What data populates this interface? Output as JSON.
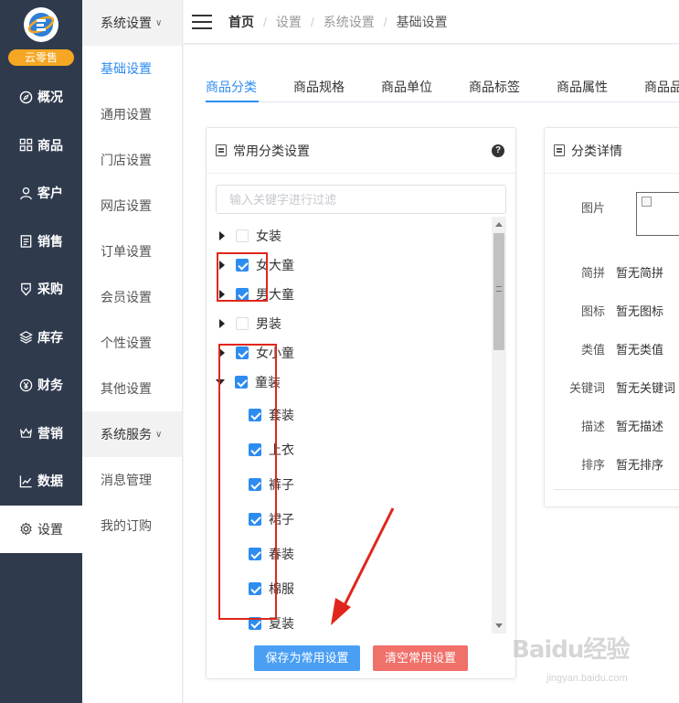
{
  "logo": {
    "badge": "云零售"
  },
  "nav": [
    {
      "label": "概况",
      "icon": "compass-icon"
    },
    {
      "label": "商品",
      "icon": "grid-icon"
    },
    {
      "label": "客户",
      "icon": "user-icon"
    },
    {
      "label": "销售",
      "icon": "clipboard-icon"
    },
    {
      "label": "采购",
      "icon": "badge-icon"
    },
    {
      "label": "库存",
      "icon": "layers-icon"
    },
    {
      "label": "财务",
      "icon": "yen-icon"
    },
    {
      "label": "营销",
      "icon": "crown-icon"
    },
    {
      "label": "数据",
      "icon": "chart-icon"
    },
    {
      "label": "设置",
      "icon": "gear-icon",
      "active": true
    }
  ],
  "submenu": {
    "group1": "系统设置",
    "items1": [
      "基础设置",
      "通用设置",
      "门店设置",
      "网店设置",
      "订单设置",
      "会员设置",
      "个性设置",
      "其他设置"
    ],
    "group2": "系统服务",
    "items2": [
      "消息管理",
      "我的订购"
    ]
  },
  "breadcrumb": [
    "首页",
    "设置",
    "系统设置",
    "基础设置"
  ],
  "tabs": [
    "商品分类",
    "商品规格",
    "商品单位",
    "商品标签",
    "商品属性",
    "商品品"
  ],
  "left_card": {
    "title": "常用分类设置",
    "help": "?",
    "filter_placeholder": "输入关键字进行过滤",
    "nodes": [
      {
        "label": "女装",
        "checked": false,
        "arrow": "right"
      },
      {
        "label": "女大童",
        "checked": true,
        "arrow": "right"
      },
      {
        "label": "男大童",
        "checked": true,
        "arrow": "right"
      },
      {
        "label": "男装",
        "checked": false,
        "arrow": "right"
      },
      {
        "label": "女小童",
        "checked": true,
        "arrow": "right"
      },
      {
        "label": "童装",
        "checked": true,
        "arrow": "down"
      },
      {
        "label": "套装",
        "checked": true,
        "child": true
      },
      {
        "label": "上衣",
        "checked": true,
        "child": true
      },
      {
        "label": "裤子",
        "checked": true,
        "child": true
      },
      {
        "label": "裙子",
        "checked": true,
        "child": true
      },
      {
        "label": "春装",
        "checked": true,
        "child": true
      },
      {
        "label": "棉服",
        "checked": true,
        "child": true
      },
      {
        "label": "夏装",
        "checked": true,
        "child": true
      }
    ],
    "save_button": "保存为常用设置",
    "clear_button": "清空常用设置"
  },
  "right_card": {
    "title": "分类详情",
    "image_label": "图片",
    "rows": [
      {
        "k": "简拼",
        "v": "暂无简拼"
      },
      {
        "k": "图标",
        "v": "暂无图标"
      },
      {
        "k": "类值",
        "v": "暂无类值"
      },
      {
        "k": "关键词",
        "v": "暂无关键词"
      },
      {
        "k": "描述",
        "v": "暂无描述"
      },
      {
        "k": "排序",
        "v": "暂无排序"
      }
    ]
  },
  "watermark": {
    "main": "Baidu经验",
    "sub": "jingyan.baidu.com"
  },
  "colors": {
    "nav_bg": "#2f3a4d",
    "accent": "#2d8cf0",
    "save": "#4a9ff5",
    "clear": "#f0706a",
    "badge": "#f5a623",
    "annotation": "#e0261c"
  }
}
